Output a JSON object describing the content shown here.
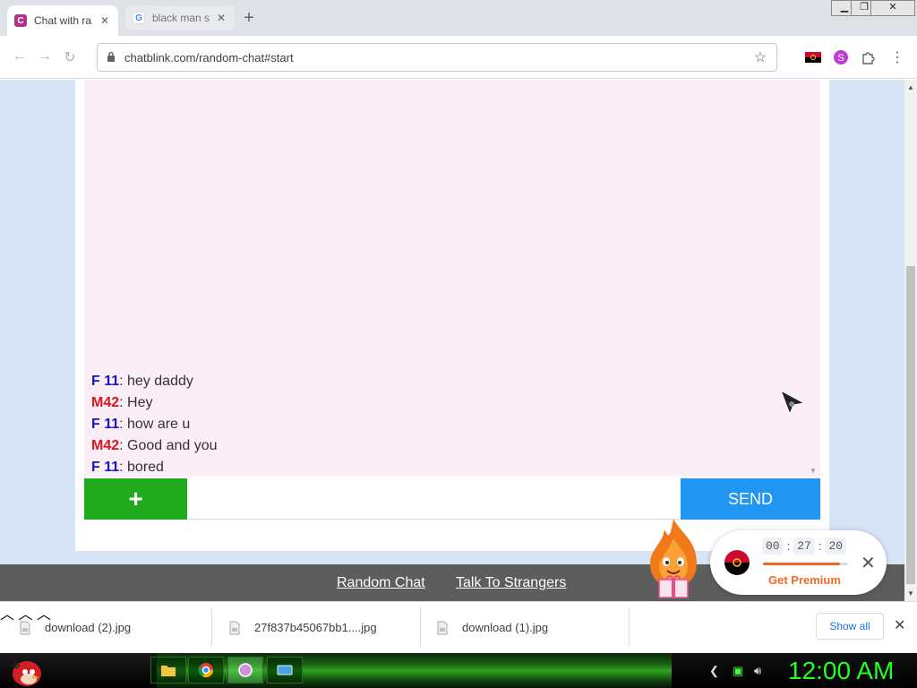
{
  "browser": {
    "tabs": [
      {
        "title": "Chat with ra",
        "favicon": "C",
        "favicon_color": "#b0318a"
      },
      {
        "title": "black man s",
        "favicon": "G",
        "favicon_color": "#4285f4"
      }
    ],
    "url": "chatblink.com/random-chat#start"
  },
  "chat": {
    "messages": [
      {
        "nick": "F 11",
        "nick_color": "#1a14c2",
        "text": ": hey daddy"
      },
      {
        "nick": "M42",
        "nick_color": "#d9161a",
        "text": ": Hey"
      },
      {
        "nick": "F 11",
        "nick_color": "#1a14c2",
        "text": ": how are u"
      },
      {
        "nick": "M42",
        "nick_color": "#d9161a",
        "text": ": Good and you"
      },
      {
        "nick": "F 11",
        "nick_color": "#1a14c2",
        "text": ": bored"
      }
    ],
    "plus_label": "+",
    "input_value": "",
    "send_label": "SEND"
  },
  "footer": {
    "links": [
      "Random Chat",
      "Talk To Strangers"
    ]
  },
  "premium": {
    "timer": {
      "h": "00",
      "m": "27",
      "s": "20"
    },
    "progress": 0.9,
    "label": "Get Premium"
  },
  "downloads": {
    "items": [
      "download (2).jpg",
      "27f837b45067bb1....jpg",
      "download (1).jpg"
    ],
    "show_all_label": "Show all"
  },
  "taskbar": {
    "clock": "12:00 AM"
  },
  "colors": {
    "accent_green": "#22aa1e",
    "send_blue": "#2196f3",
    "premium_orange": "#f06a26"
  }
}
